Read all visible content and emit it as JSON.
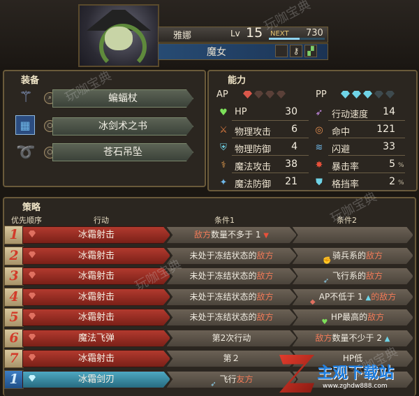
{
  "character": {
    "name": "雅娜",
    "level_label": "Lv",
    "level": "15",
    "next_label": "NEXT",
    "next_value": "730",
    "next_progress": 0.55,
    "class_name": "魔女"
  },
  "equipment_section": {
    "title": "装备",
    "items": [
      {
        "icon": "staff-icon",
        "slot_icon": "search-icon",
        "name": "蝙蝠杖"
      },
      {
        "icon": "book-icon",
        "slot_icon": "ring-icon",
        "name": "冰剑术之书"
      },
      {
        "icon": "necklace-icon",
        "slot_icon": "ring-icon",
        "name": "苍石吊坠"
      }
    ]
  },
  "ability_section": {
    "title": "能力",
    "ap_label": "AP",
    "ap_filled": 1,
    "ap_total": 4,
    "pp_label": "PP",
    "pp_filled": 3,
    "pp_total": 5,
    "left_stats": [
      {
        "icon": "heart-icon",
        "label": "HP",
        "value": "30"
      },
      {
        "icon": "sword-icon",
        "label": "物理攻击",
        "value": "6"
      },
      {
        "icon": "armor-icon",
        "label": "物理防御",
        "value": "4"
      },
      {
        "icon": "magic-wand-icon",
        "label": "魔法攻击",
        "value": "38"
      },
      {
        "icon": "magic-shield-icon",
        "label": "魔法防御",
        "value": "21"
      }
    ],
    "right_stats": [
      {
        "icon": "speed-icon",
        "label": "行动速度",
        "value": "14",
        "unit": ""
      },
      {
        "icon": "target-icon",
        "label": "命中",
        "value": "121",
        "unit": ""
      },
      {
        "icon": "evade-icon",
        "label": "闪避",
        "value": "33",
        "unit": ""
      },
      {
        "icon": "crit-icon",
        "label": "暴击率",
        "value": "5",
        "unit": "%"
      },
      {
        "icon": "block-icon",
        "label": "格挡率",
        "value": "2",
        "unit": "%"
      }
    ]
  },
  "tactics_section": {
    "title": "策略",
    "headers": {
      "priority": "优先顺序",
      "action": "行动",
      "cond1": "条件1",
      "cond2": "条件2"
    },
    "rows": [
      {
        "num": "1",
        "action": "冰霜射击",
        "cond1_a": "敌方",
        "cond1_b": "数量不多于 1",
        "cond1_icon": "red-triangle-down",
        "cond2_icon": "",
        "cond2_a": "",
        "cond2_b": "",
        "selected": false
      },
      {
        "num": "2",
        "action": "冰霜射击",
        "cond1_a": "未处于冻结状态的",
        "cond1_b": "敌方",
        "cond1_icon": "",
        "cond2_icon": "fist-icon",
        "cond2_a": "骑兵系的",
        "cond2_b": "敌方",
        "selected": false
      },
      {
        "num": "3",
        "action": "冰霜射击",
        "cond1_a": "未处于冻结状态的",
        "cond1_b": "敌方",
        "cond1_icon": "",
        "cond2_icon": "wing-icon",
        "cond2_a": "飞行系的",
        "cond2_b": "敌方",
        "selected": false
      },
      {
        "num": "4",
        "action": "冰霜射击",
        "cond1_a": "未处于冻结状态的",
        "cond1_b": "敌方",
        "cond1_icon": "",
        "cond2_icon": "red-gem-icon",
        "cond2_a": "AP不低于 1",
        "cond2_b": "的敌方",
        "selected": false
      },
      {
        "num": "5",
        "action": "冰霜射击",
        "cond1_a": "未处于冻结状态的",
        "cond1_b": "敌方",
        "cond1_icon": "",
        "cond2_icon": "heart-icon",
        "cond2_a": "HP最高的",
        "cond2_b": "敌方",
        "selected": false
      },
      {
        "num": "6",
        "action": "魔法飞弹",
        "cond1_a": "第2次行动",
        "cond1_b": "",
        "cond1_icon": "",
        "cond2_icon": "",
        "cond2_a": "敌方",
        "cond2_b": "数量不少于 2",
        "selected": false
      },
      {
        "num": "7",
        "action": "冰霜射击",
        "cond1_a": "第２",
        "cond1_b": "",
        "cond1_icon": "",
        "cond2_icon": "",
        "cond2_a": "HP",
        "cond2_b": "低",
        "selected": false
      },
      {
        "num": "1",
        "action": "冰霜剑刃",
        "cond1_a": "飞行",
        "cond1_b": "友方",
        "cond1_icon": "wing-icon",
        "cond2_icon": "",
        "cond2_a": "",
        "cond2_b": "",
        "selected": true
      }
    ]
  },
  "watermarks": [
    "玩咖宝典",
    "玩咖宝典",
    "玩咖宝典",
    "玩咖宝典",
    "玩咖宝典"
  ],
  "logo": {
    "title": "主观下载站",
    "url": "www.zghdw888.com"
  },
  "colors": {
    "enemy_text": "#f07a58",
    "ap_gem": "#d9574a",
    "pp_gem": "#6fd3e6",
    "action_red": "#b23a2e",
    "action_selected": "#4ea8c2"
  }
}
